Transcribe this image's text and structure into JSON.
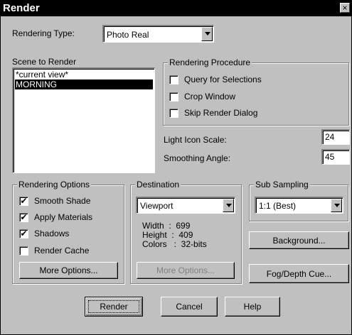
{
  "window": {
    "title": "Render",
    "close_symbol": "×"
  },
  "rendering_type": {
    "label": "Rendering Type:",
    "value": "Photo Real"
  },
  "scene": {
    "label": "Scene to Render",
    "items": [
      "*current view*",
      "MORNING"
    ],
    "selected_index": 1
  },
  "procedure": {
    "title": "Rendering Procedure",
    "options": [
      {
        "label": "Query for Selections",
        "checked": false
      },
      {
        "label": "Crop Window",
        "checked": false
      },
      {
        "label": "Skip Render Dialog",
        "checked": false
      }
    ]
  },
  "light_icon_scale": {
    "label": "Light Icon Scale:",
    "value": "24"
  },
  "smoothing_angle": {
    "label": "Smoothing Angle:",
    "value": "45"
  },
  "rendering_options": {
    "title": "Rendering Options",
    "options": [
      {
        "label": "Smooth Shade",
        "checked": true
      },
      {
        "label": "Apply Materials",
        "checked": true
      },
      {
        "label": "Shadows",
        "checked": true
      },
      {
        "label": "Render Cache",
        "checked": false
      }
    ],
    "more_button": "More Options..."
  },
  "destination": {
    "title": "Destination",
    "value": "Viewport",
    "width": "Width  :  699",
    "height": "Height  :  409",
    "colors": "Colors   :  32-bits",
    "more_button": "More Options..."
  },
  "sub_sampling": {
    "title": "Sub Sampling",
    "value": "1:1 (Best)"
  },
  "buttons": {
    "background": "Background...",
    "fog": "Fog/Depth Cue...",
    "render": "Render",
    "cancel": "Cancel",
    "help": "Help"
  },
  "check_mark": "✔"
}
